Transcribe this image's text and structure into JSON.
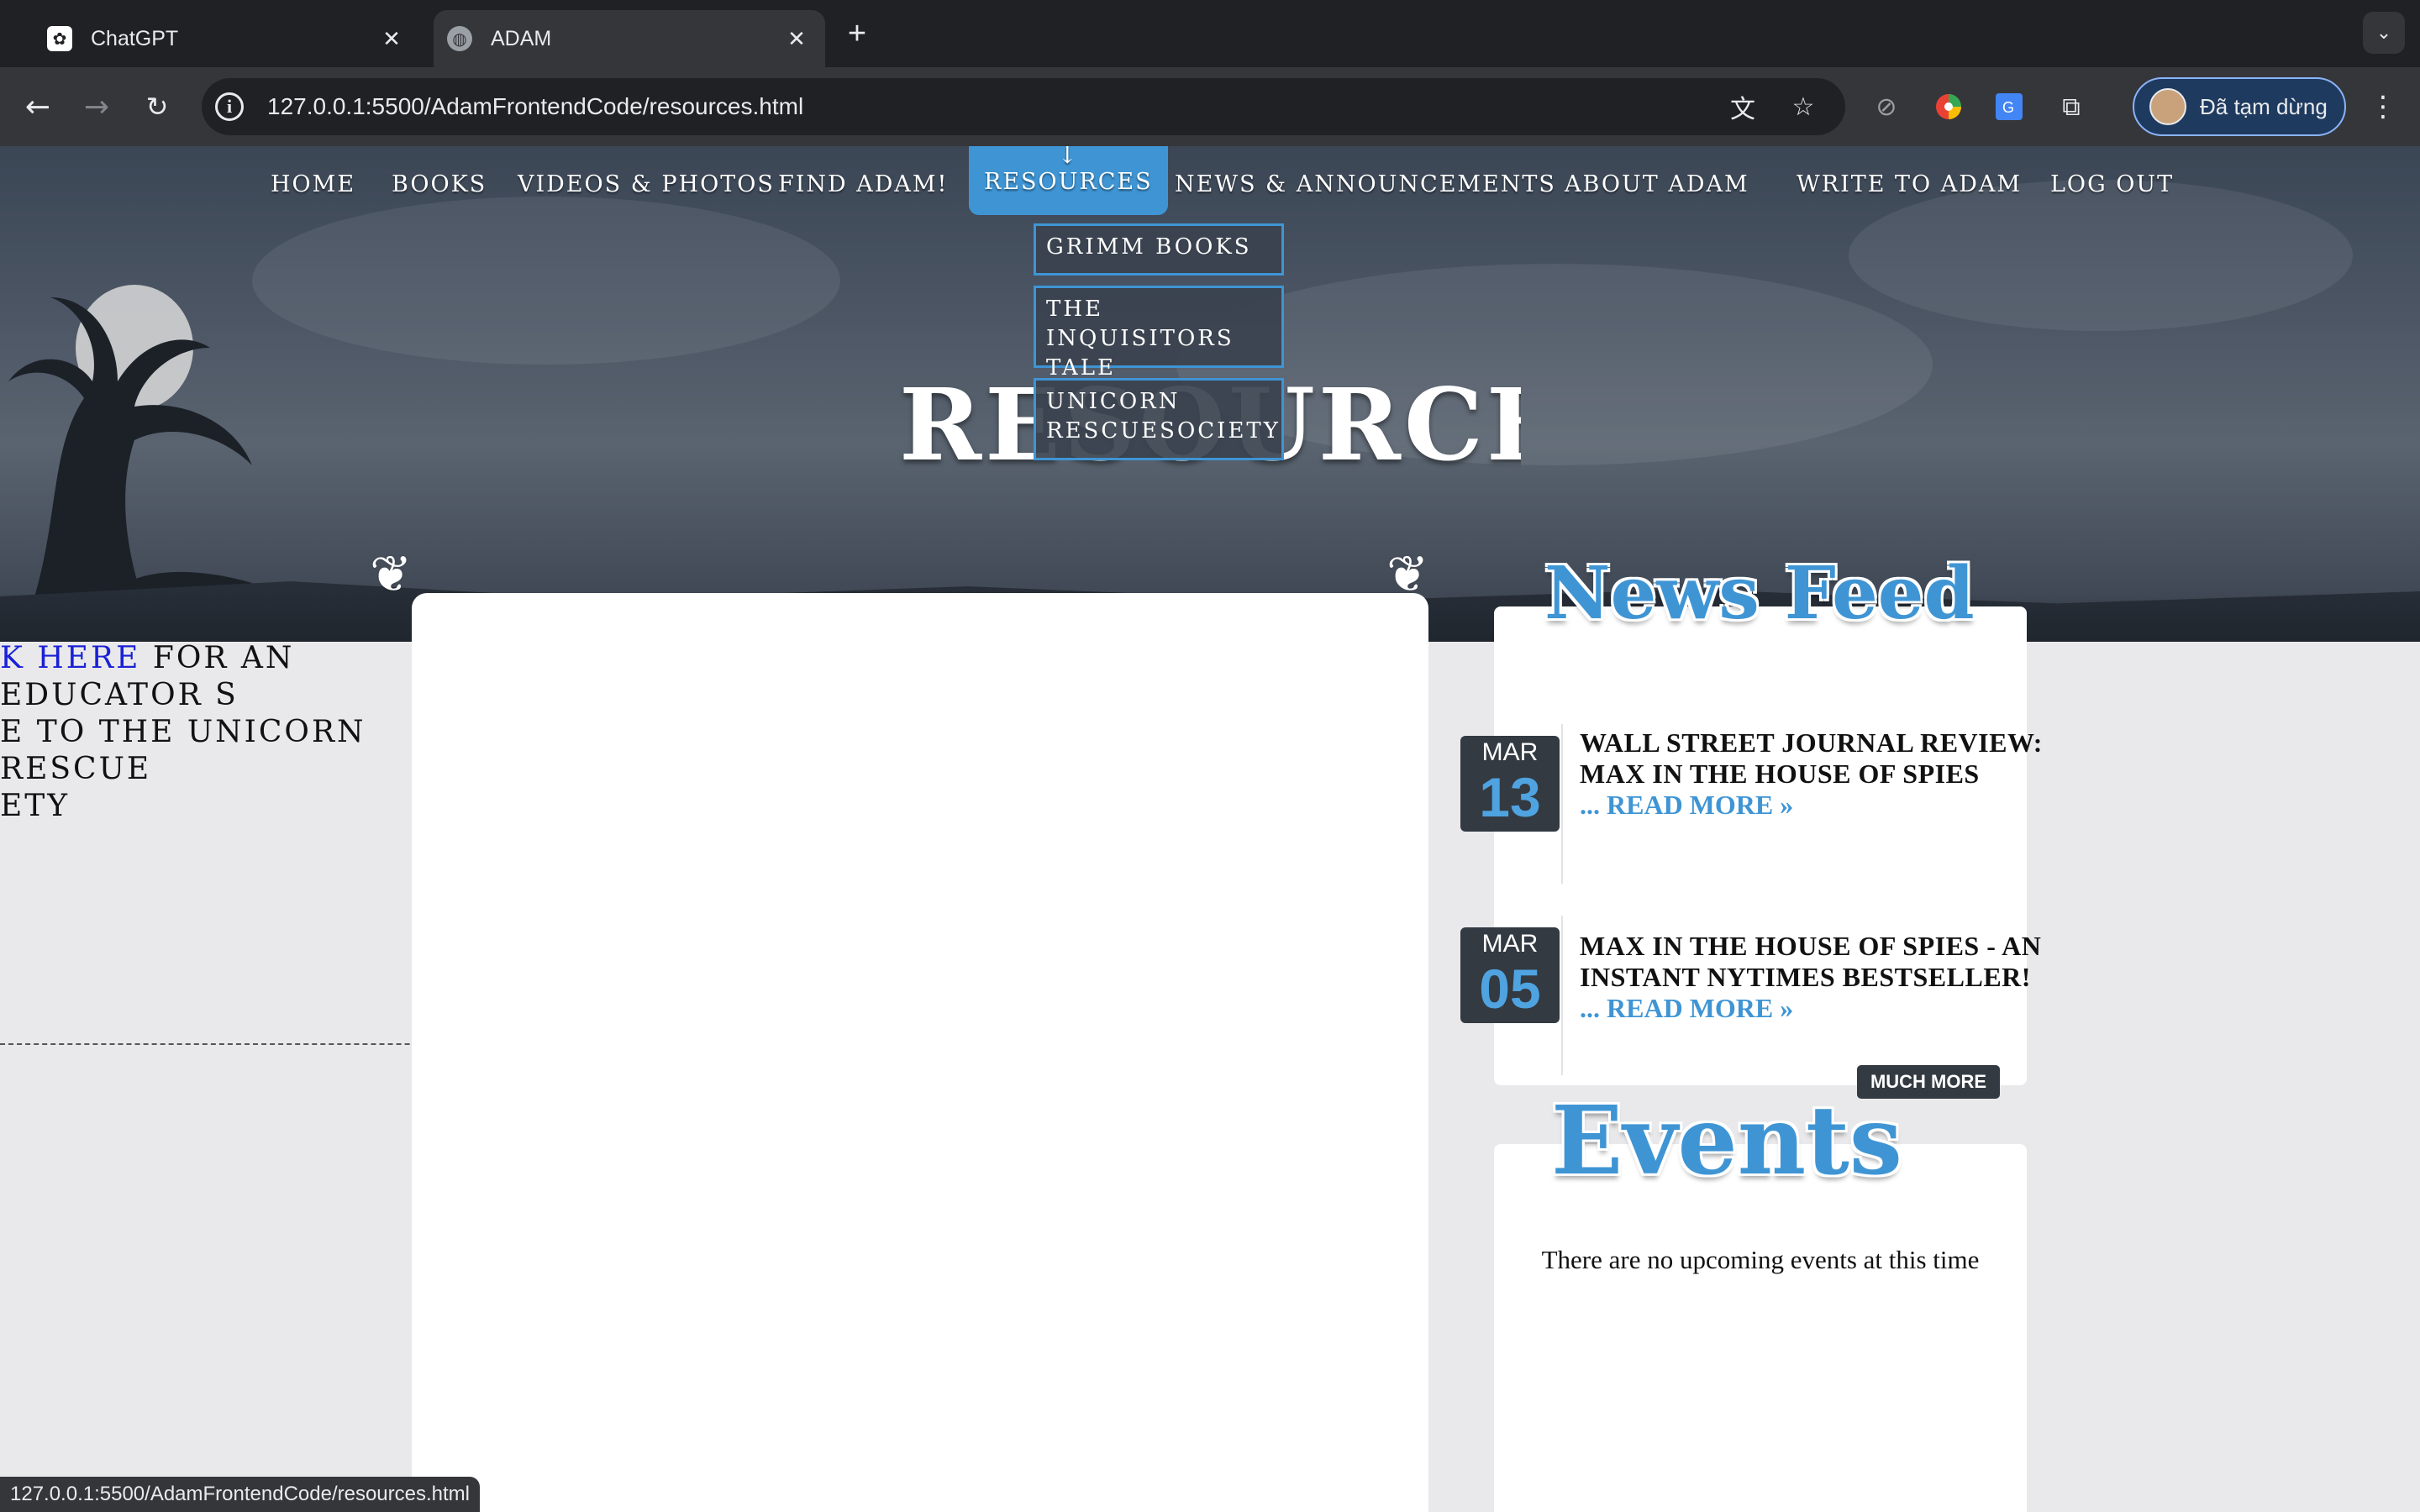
{
  "browser": {
    "tabs": [
      {
        "title": "ChatGPT",
        "favicon": "openai-icon",
        "active": false
      },
      {
        "title": "ADAM",
        "favicon": "globe-icon",
        "active": true
      }
    ],
    "new_tab_symbol": "+",
    "url": "127.0.0.1:5500/AdamFrontendCode/resources.html",
    "profile_label": "Đã tạm dừng",
    "status_url": "127.0.0.1:5500/AdamFrontendCode/resources.html"
  },
  "nav": {
    "items": [
      {
        "label": "HOME"
      },
      {
        "label": "BOOKS"
      },
      {
        "label": "VIDEOS & PHOTOS"
      },
      {
        "label": "FIND ADAM!"
      },
      {
        "label": "RESOURCES",
        "active": true
      },
      {
        "label": "NEWS & ANNOUNCEMENTS"
      },
      {
        "label": "ABOUT ADAM"
      },
      {
        "label": "WRITE TO ADAM"
      },
      {
        "label": "LOG OUT"
      }
    ],
    "dropdown": [
      {
        "label": "GRIMM BOOKS"
      },
      {
        "label": "THE INQUISITORS TALE"
      },
      {
        "label": "UNICORN RESCUESOCIETY"
      }
    ]
  },
  "page": {
    "title": "RESOURCES",
    "left_text": {
      "link": "K HERE",
      "rest_line1": " FOR AN EDUCATOR S",
      "line2": "E TO THE UNICORN RESCUE",
      "line3": "ETY"
    }
  },
  "sidebar": {
    "news_heading": "News Feed",
    "news": [
      {
        "month": "MAR",
        "day": "13",
        "title": "WALL STREET JOURNAL REVIEW: MAX IN THE HOUSE OF SPIES",
        "more": "... READ MORE »"
      },
      {
        "month": "MAR",
        "day": "05",
        "title": "MAX IN THE HOUSE OF SPIES - AN INSTANT NYTIMES BESTSELLER!",
        "more": "... READ MORE »"
      }
    ],
    "much_more": "MUCH MORE",
    "events_heading": "Events",
    "events_empty": "There are no upcoming events at this time"
  },
  "colors": {
    "accent": "#3f95d4",
    "date_badge": "#333a42",
    "link": "#1a21d6"
  }
}
